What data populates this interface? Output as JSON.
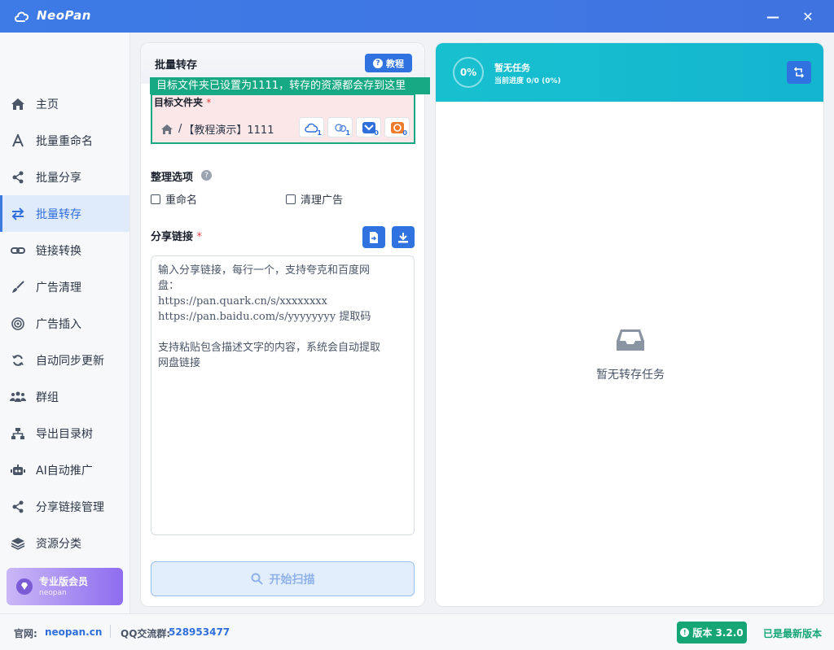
{
  "app": {
    "title": "NeoPan"
  },
  "window": {
    "minimize": "—",
    "close": "✕"
  },
  "sidebar": {
    "items": [
      {
        "label": "主页",
        "icon": "home-icon"
      },
      {
        "label": "批量重命名",
        "icon": "font-icon"
      },
      {
        "label": "批量分享",
        "icon": "share-icon"
      },
      {
        "label": "批量转存",
        "icon": "transfer-icon",
        "active": true
      },
      {
        "label": "链接转换",
        "icon": "link-icon"
      },
      {
        "label": "广告清理",
        "icon": "brush-icon"
      },
      {
        "label": "广告插入",
        "icon": "target-icon"
      },
      {
        "label": "自动同步更新",
        "icon": "sync-icon"
      },
      {
        "label": "群组",
        "icon": "users-icon"
      },
      {
        "label": "导出目录树",
        "icon": "sitemap-icon"
      },
      {
        "label": "AI自动推广",
        "icon": "robot-icon"
      },
      {
        "label": "分享链接管理",
        "icon": "share-icon"
      },
      {
        "label": "资源分类",
        "icon": "layers-icon"
      }
    ],
    "vip": {
      "title": "专业版会员",
      "user": "neopan"
    }
  },
  "main": {
    "title": "批量转存",
    "tutorial_label": "教程",
    "tooltip": "目标文件夹已设置为1111，转存的资源都会存到这里",
    "target": {
      "label": "目标文件夹",
      "required": "*",
      "path_sep": "/",
      "path": "【教程演示】1111",
      "clouds": [
        {
          "icon": "quark-cloud-icon",
          "count": "1"
        },
        {
          "icon": "baidu-cloud-icon",
          "count": "1"
        },
        {
          "icon": "xunlei-icon",
          "count": "0"
        },
        {
          "icon": "uc-icon",
          "count": "0"
        }
      ]
    },
    "options": {
      "title": "整理选项",
      "help": "?",
      "rename_label": "重命名",
      "clean_ads_label": "清理广告"
    },
    "share": {
      "label": "分享链接",
      "required": "*",
      "placeholder": "输入分享链接，每行一个，支持夸克和百度网\n盘：\nhttps://pan.quark.cn/s/xxxxxxxx\nhttps://pan.baidu.com/s/yyyyyyyy 提取码\n\n支持粘贴包含描述文字的内容，系统会自动提取\n网盘链接"
    },
    "scan_button": "开始扫描"
  },
  "tasks": {
    "percent": "0%",
    "status": "暂无任务",
    "progress_label": "当前进度 0/0 (0%)",
    "empty": "暂无转存任务"
  },
  "footer": {
    "site_label": "官网:",
    "site": "neopan.cn",
    "qq_label": "QQ交流群:",
    "qq": "528953477",
    "version": "版本 3.2.0",
    "latest": "已是最新版本"
  },
  "colors": {
    "titlebar": "#3e7be6",
    "accent": "#2f72e0",
    "tooltip": "#17a884",
    "task_header": "#17c0cf",
    "version_badge": "#16a676"
  }
}
